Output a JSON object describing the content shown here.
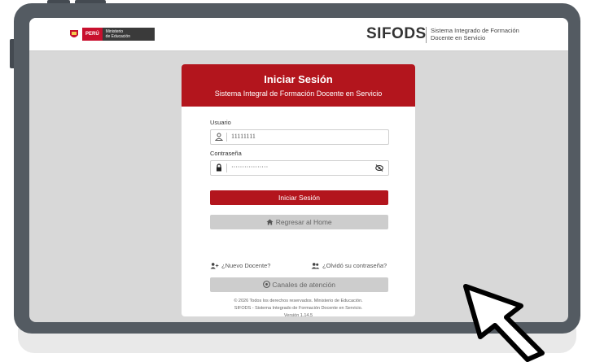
{
  "topbar": {
    "peru_label": "PERÚ",
    "ministry_line1": "Ministerio",
    "ministry_line2": "de Educación",
    "product_name": "SIFODS",
    "product_sub_line1": "Sistema Integrado de Formación",
    "product_sub_line2": "Docente en Servicio"
  },
  "login": {
    "title": "Iniciar Sesión",
    "subtitle": "Sistema Integral de Formación Docente en Servicio",
    "username_label": "Usuario",
    "username_value": "11111111",
    "password_label": "Contraseña",
    "password_value": "·················",
    "submit_label": "Iniciar Sesión",
    "home_label": "Regresar al Home",
    "new_teacher_label": "¿Nuevo Docente?",
    "forgot_label": "¿Olvidó su contraseña?",
    "support_label": "Canales de atención",
    "footer_line1": "© 2026 Todos los derechos reservados. Ministerio de Educación.",
    "footer_line2": "SIFODS - Sistema Integrado de Formación Docente en Servicio.",
    "footer_line3": "Versión 1.14.5"
  },
  "colors": {
    "brand_red": "#b3151d",
    "frame": "#545b62",
    "screen_bg": "#d8d8d8"
  },
  "icons": [
    "user-icon",
    "lock-icon",
    "eye-slash-icon",
    "home-icon",
    "user-plus-icon",
    "users-icon",
    "headset-icon",
    "cursor-arrow-icon"
  ]
}
